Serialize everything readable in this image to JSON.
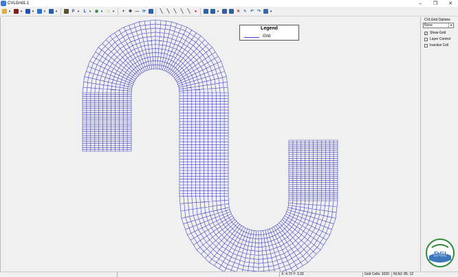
{
  "window": {
    "title": "CVLGrid1.1"
  },
  "toolbar": {
    "items": [
      {
        "icon": "folder-icon",
        "color": "#e0b030",
        "drop": true
      },
      {
        "icon": "stop-icon",
        "color": "#7a2020",
        "drop": true
      },
      {
        "icon": "bars-icon",
        "color": "#2050c0",
        "drop": true
      },
      {
        "icon": "layers-icon",
        "color": "#3070c0",
        "drop": true
      },
      {
        "icon": "grid-tools-icon",
        "color": "#2060b0",
        "drop": true
      },
      {
        "icon": "terrain-icon",
        "color": "#605030",
        "drop": false
      },
      {
        "icon": "p-icon",
        "color": "#2050c0",
        "drop": true
      },
      {
        "icon": "l-icon",
        "color": "#2050c0",
        "drop": true
      },
      {
        "icon": "globe-icon",
        "color": "#2a8a40",
        "drop": true
      },
      {
        "icon": "square-select-icon",
        "color": "#d0a000",
        "drop": true
      },
      {
        "icon": "plus-icon",
        "color": "#333333",
        "drop": false
      },
      {
        "icon": "move-icon",
        "color": "#333333",
        "drop": false
      },
      {
        "icon": "minus-icon",
        "color": "#333333",
        "drop": false
      },
      {
        "icon": "refresh-icon",
        "color": "#2070c0",
        "drop": false
      },
      {
        "icon": "table-icon",
        "color": "#3060a0",
        "drop": false
      },
      {
        "icon": "line-tool-icon",
        "color": "#3a3a3a",
        "drop": false
      },
      {
        "icon": "curve-tool-icon",
        "color": "#3a3a3a",
        "drop": false
      },
      {
        "icon": "spline-tool-icon",
        "color": "#3a3a3a",
        "drop": false
      },
      {
        "icon": "split-tool-icon",
        "color": "#3a3a3a",
        "drop": false
      },
      {
        "icon": "merge-tool-icon",
        "color": "#3a3a3a",
        "drop": false
      },
      {
        "icon": "red-circle-icon",
        "color": "#d02020",
        "drop": false
      },
      {
        "icon": "grid-view-icon",
        "color": "#3060a0",
        "drop": false
      },
      {
        "icon": "zoom-extent-icon",
        "color": "#3060a0",
        "drop": true
      },
      {
        "icon": "zoom-window-icon",
        "color": "#3060a0",
        "drop": false
      },
      {
        "icon": "zoom-in-icon",
        "color": "#3060a0",
        "drop": false
      },
      {
        "icon": "delete-icon",
        "color": "#c02020",
        "drop": false
      },
      {
        "icon": "pointer-icon",
        "color": "#3060a0",
        "drop": false
      },
      {
        "icon": "undo-icon",
        "color": "#2060c0",
        "drop": false
      },
      {
        "icon": "redo-icon",
        "color": "#2060c0",
        "drop": false
      },
      {
        "icon": "print-icon",
        "color": "#3a6ab0",
        "drop": true
      }
    ]
  },
  "legend": {
    "title": "Legend",
    "items": [
      {
        "label": "Grid",
        "color": "#4040c8"
      }
    ]
  },
  "panel": {
    "title": "CVLGrid Options",
    "select_value": "None",
    "checkboxes": [
      {
        "label": "Show Grid",
        "checked": true
      },
      {
        "label": "Layer Control",
        "checked": false
      },
      {
        "label": "Inactive Cell",
        "checked": false
      }
    ]
  },
  "logo": {
    "text": "DSI"
  },
  "status": {
    "coords": "X: 4.70  Y: 3.33",
    "cells": "Grid Cells: 1020",
    "ninj": "NI,NJ: 85, 12"
  },
  "colors": {
    "grid": "#4040c8",
    "logo_green": "#2e8b3a",
    "logo_blue": "#1a5fb0"
  }
}
